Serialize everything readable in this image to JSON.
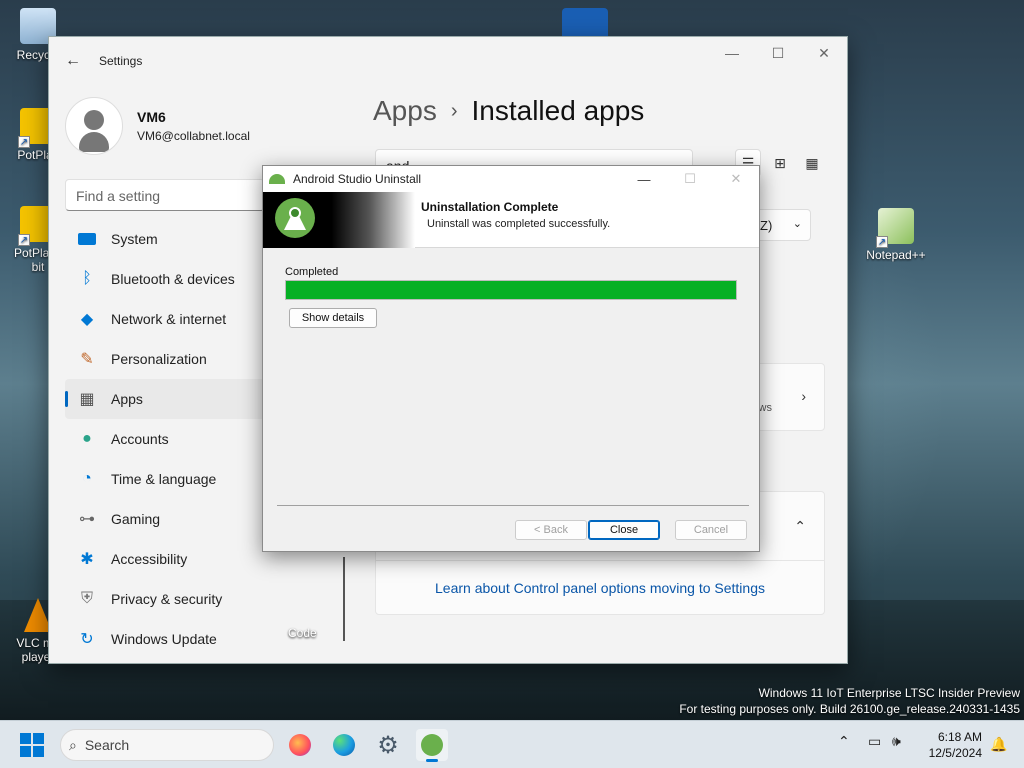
{
  "desktop": {
    "icons": [
      {
        "label": "Recycle"
      },
      {
        "label": "PotPlay"
      },
      {
        "label": "PotPlaye",
        "label2": "bit"
      },
      {
        "label": "Notepad++"
      },
      {
        "label": "VLC me",
        "label2": "player"
      }
    ],
    "code_label": "Code",
    "watermark_line1": "Windows 11 IoT Enterprise LTSC Insider Preview",
    "watermark_line2": "For testing purposes only. Build 26100.ge_release.240331-1435"
  },
  "settings": {
    "title": "Settings",
    "user_name": "VM6",
    "user_email": "VM6@collabnet.local",
    "search_placeholder": "Find a setting",
    "nav": [
      {
        "label": "System",
        "icon": "system-icon"
      },
      {
        "label": "Bluetooth & devices",
        "icon": "bluetooth-icon"
      },
      {
        "label": "Network & internet",
        "icon": "network-icon"
      },
      {
        "label": "Personalization",
        "icon": "brush-icon"
      },
      {
        "label": "Apps",
        "icon": "apps-icon",
        "active": true
      },
      {
        "label": "Accounts",
        "icon": "accounts-icon"
      },
      {
        "label": "Time & language",
        "icon": "clock-globe-icon"
      },
      {
        "label": "Gaming",
        "icon": "gamepad-icon"
      },
      {
        "label": "Accessibility",
        "icon": "accessibility-icon"
      },
      {
        "label": "Privacy & security",
        "icon": "shield-icon"
      },
      {
        "label": "Windows Update",
        "icon": "update-icon"
      }
    ],
    "breadcrumb_parent": "Apps",
    "breadcrumb_current": "Installed apps",
    "app_search_value": "and",
    "sort_value": "Z)",
    "card1_sub": "ws",
    "control_panel_link": "Learn about Control panel options moving to Settings"
  },
  "dialog": {
    "title": "Android Studio Uninstall",
    "header_title": "Uninstallation Complete",
    "header_subtitle": "Uninstall was completed successfully.",
    "status": "Completed",
    "progress": 1.0,
    "show_details": "Show details",
    "back": "< Back",
    "close": "Close",
    "cancel": "Cancel"
  },
  "taskbar": {
    "search_placeholder": "Search",
    "apps": [
      "firefox-icon",
      "edge-icon",
      "settings-gear-icon",
      "android-studio-icon"
    ],
    "time": "6:18 AM",
    "date": "12/5/2024"
  },
  "colors": {
    "accent": "#0078d4",
    "progress_fill": "#06b025",
    "link": "#0a56a8",
    "android_green": "#6ab04c"
  }
}
